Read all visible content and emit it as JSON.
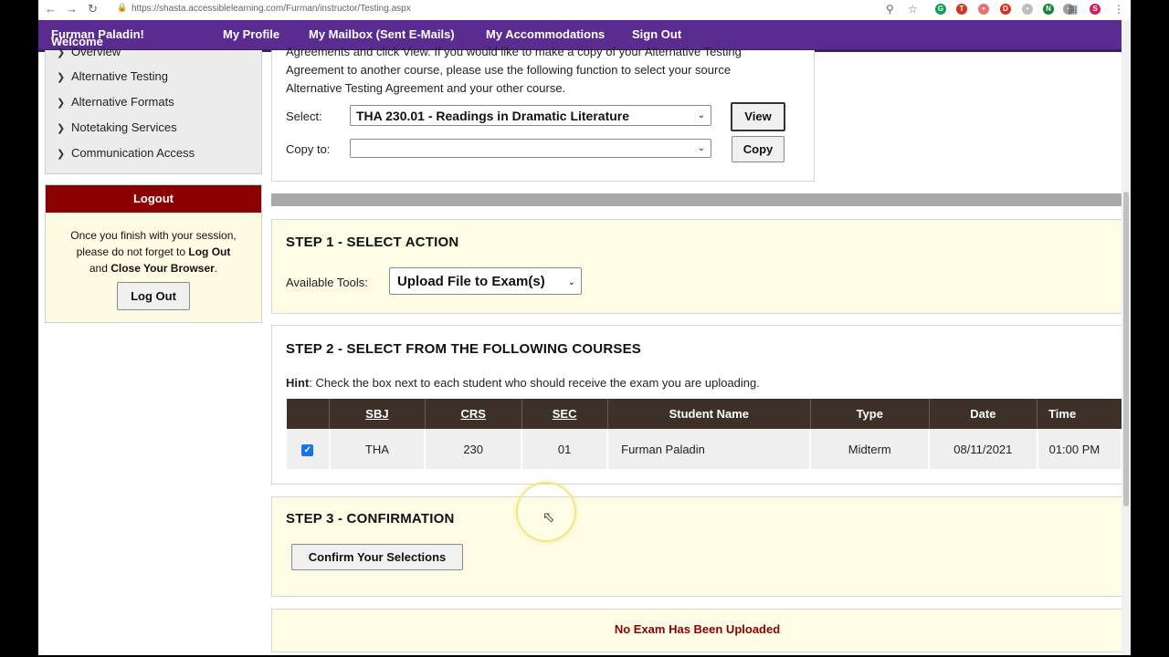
{
  "browser": {
    "url": "https://shasta.accessiblelearning.com/Furman/instructor/Testing.aspx",
    "profile_initial": "S"
  },
  "topnav": {
    "welcome_prefix": "Welcome",
    "welcome_name": "Furman Paladin!",
    "items": [
      "My Profile",
      "My Mailbox (Sent E-Mails)",
      "My Accommodations",
      "Sign Out"
    ]
  },
  "sidebar": {
    "items": [
      "Overview",
      "Alternative Testing",
      "Alternative Formats",
      "Notetaking Services",
      "Communication Access"
    ]
  },
  "logout": {
    "header": "Logout",
    "msg_line1": "Once you finish with your session,",
    "msg_line2_pre": "please do not forget to ",
    "msg_line2_bold": "Log Out",
    "msg_line3_pre": "and ",
    "msg_line3_bold": "Close Your Browser",
    "msg_line3_post": ".",
    "button": "Log Out"
  },
  "agreement": {
    "line1": "Agreements and click View. If you would like to make a copy of your Alternative Testing",
    "line2": "Agreement to another course, please use the following function to select your source",
    "line3": "Alternative Testing Agreement and your other course.",
    "select_label": "Select:",
    "select_value": "THA 230.01 - Readings in Dramatic Literature",
    "view_button": "View",
    "copy_label": "Copy to:",
    "copy_value": "",
    "copy_button": "Copy"
  },
  "step1": {
    "title": "STEP 1 - SELECT ACTION",
    "tools_label": "Available Tools:",
    "tools_value": "Upload File to Exam(s)"
  },
  "step2": {
    "title": "STEP 2 - SELECT FROM THE FOLLOWING COURSES",
    "hint_bold": "Hint",
    "hint_text": ": Check the box next to each student who should receive the exam you are uploading.",
    "columns": [
      "",
      "SBJ",
      "CRS",
      "SEC",
      "Student Name",
      "Type",
      "Date",
      "Time"
    ],
    "rows": [
      {
        "checked": true,
        "sbj": "THA",
        "crs": "230",
        "sec": "01",
        "student": "Furman Paladin",
        "type": "Midterm",
        "date": "08/11/2021",
        "time": "01:00 PM"
      }
    ]
  },
  "step3": {
    "title": "STEP 3 - CONFIRMATION",
    "button": "Confirm Your Selections"
  },
  "status": {
    "message": "No Exam Has Been Uploaded"
  },
  "colors": {
    "nav_purple": "#5b2c8f",
    "logout_red": "#8b0000",
    "step_yellow": "#fdfde5",
    "table_header": "#3d3028",
    "status_red": "#8b0000"
  }
}
